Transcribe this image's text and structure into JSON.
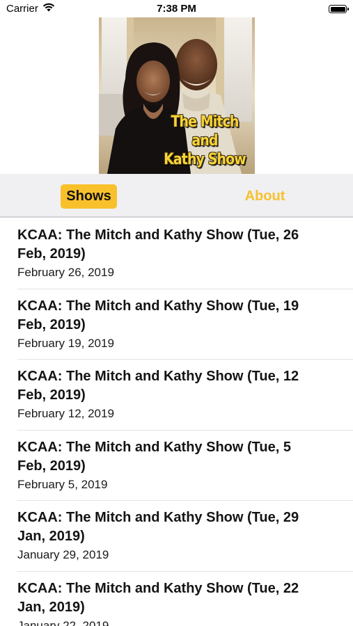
{
  "status_bar": {
    "carrier": "Carrier",
    "time": "7:38 PM"
  },
  "header": {
    "cover_title_line1": "The Mitch",
    "cover_title_line2": "and",
    "cover_title_line3": "Kathy Show"
  },
  "tabs": {
    "shows_label": "Shows",
    "about_label": "About",
    "active": "Shows",
    "accent_color": "#f8c12c"
  },
  "episodes": [
    {
      "title": "KCAA: The Mitch and Kathy Show (Tue, 26 Feb, 2019)",
      "date": "February 26, 2019"
    },
    {
      "title": "KCAA: The Mitch and Kathy Show (Tue, 19 Feb, 2019)",
      "date": "February 19, 2019"
    },
    {
      "title": "KCAA: The Mitch and Kathy Show (Tue, 12 Feb, 2019)",
      "date": "February 12, 2019"
    },
    {
      "title": "KCAA: The Mitch and Kathy Show (Tue, 5 Feb, 2019)",
      "date": "February 5, 2019"
    },
    {
      "title": "KCAA: The Mitch and Kathy Show (Tue, 29 Jan, 2019)",
      "date": "January 29, 2019"
    },
    {
      "title": "KCAA: The Mitch and Kathy Show (Tue, 22 Jan, 2019)",
      "date": "January 22, 2019"
    }
  ]
}
